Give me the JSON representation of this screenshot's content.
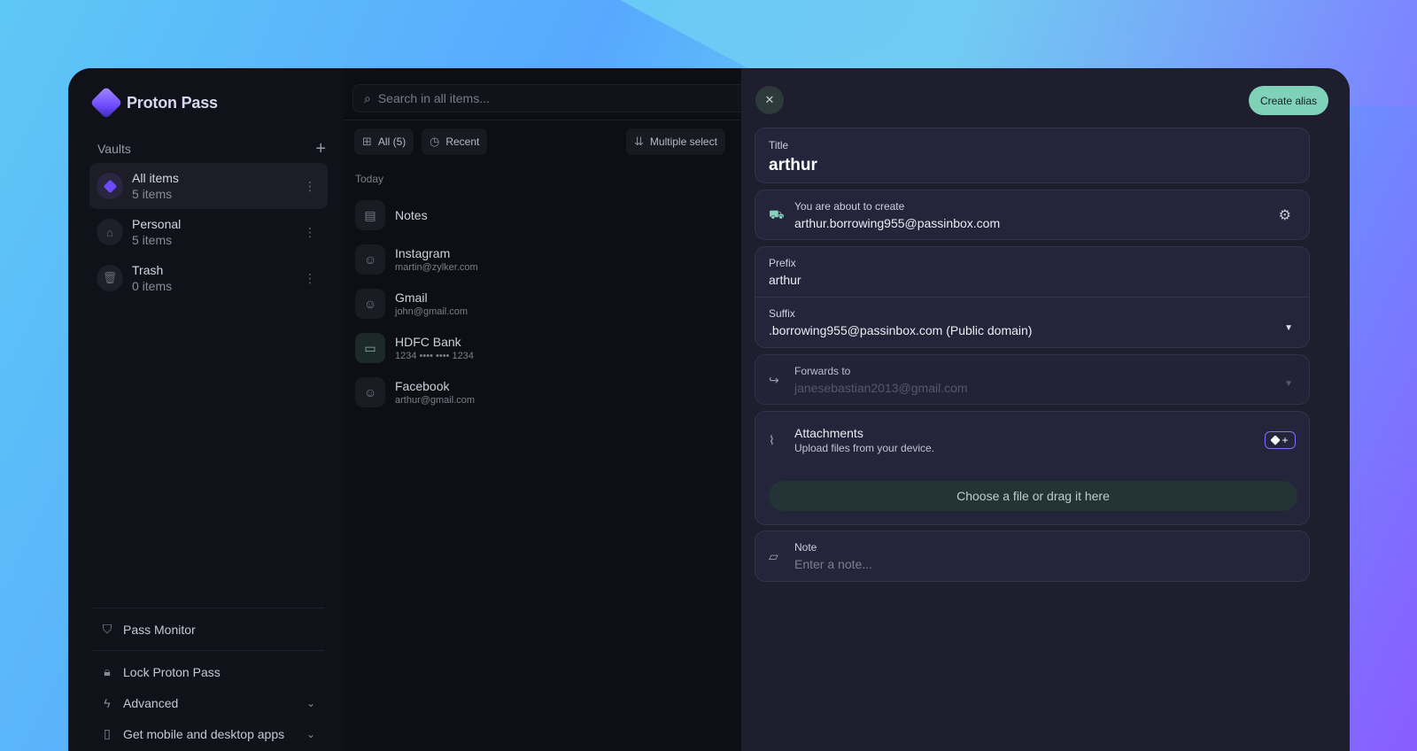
{
  "app": {
    "name": "Proton Pass"
  },
  "sidebar": {
    "vaults_title": "Vaults",
    "vaults": [
      {
        "name": "All items",
        "count": "5 items"
      },
      {
        "name": "Personal",
        "count": "5 items"
      },
      {
        "name": "Trash",
        "count": "0 items"
      }
    ],
    "links": {
      "pass_monitor": "Pass Monitor",
      "lock": "Lock Proton Pass",
      "advanced": "Advanced",
      "apps": "Get mobile and desktop apps"
    }
  },
  "list": {
    "search_placeholder": "Search in all items...",
    "filter_all": "All (5)",
    "filter_recent": "Recent",
    "multiple_select": "Multiple select",
    "section_today": "Today",
    "items": [
      {
        "title": "Notes",
        "subtitle": "",
        "icon": "note-icon"
      },
      {
        "title": "Instagram",
        "subtitle": "martin@zylker.com",
        "icon": "user-icon"
      },
      {
        "title": "Gmail",
        "subtitle": "john@gmail.com",
        "icon": "user-icon"
      },
      {
        "title": "HDFC Bank",
        "subtitle": "1234 •••• •••• 1234",
        "icon": "card-icon"
      },
      {
        "title": "Facebook",
        "subtitle": "arthur@gmail.com",
        "icon": "user-icon"
      }
    ]
  },
  "panel": {
    "create_button": "Create alias",
    "title_label": "Title",
    "title_value": "arthur",
    "create_label": "You are about to create",
    "create_value": "arthur.borrowing955@passinbox.com",
    "prefix_label": "Prefix",
    "prefix_value": "arthur",
    "suffix_label": "Suffix",
    "suffix_value": ".borrowing955@passinbox.com (Public domain)",
    "forwards_label": "Forwards to",
    "forwards_value": "janesebastian2013@gmail.com",
    "attachments_label": "Attachments",
    "attachments_sub": "Upload files from your device.",
    "dropzone_text": "Choose a file or drag it here",
    "note_label": "Note",
    "note_placeholder": "Enter a note..."
  }
}
